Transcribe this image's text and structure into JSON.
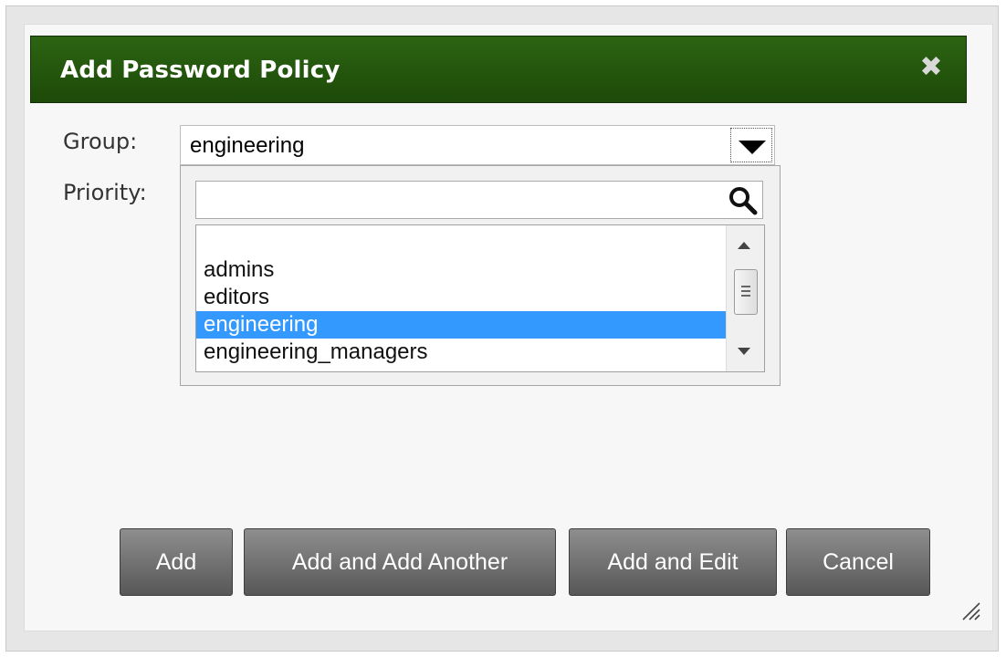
{
  "dialog": {
    "title": "Add Password Policy",
    "close_icon": "close-icon"
  },
  "form": {
    "group_label": "Group:",
    "group_value": "engineering",
    "priority_label": "Priority:"
  },
  "dropdown": {
    "search_placeholder": "",
    "search_icon": "search-icon",
    "items": [
      {
        "label": "",
        "selected": false
      },
      {
        "label": "admins",
        "selected": false
      },
      {
        "label": "editors",
        "selected": false
      },
      {
        "label": "engineering",
        "selected": true
      },
      {
        "label": "engineering_managers",
        "selected": false
      }
    ]
  },
  "buttons": {
    "add": "Add",
    "add_another": "Add and Add Another",
    "add_edit": "Add and Edit",
    "cancel": "Cancel"
  },
  "colors": {
    "titlebar": "#1d4a08",
    "selection": "#3399ff",
    "button": "#6a6a6a"
  }
}
